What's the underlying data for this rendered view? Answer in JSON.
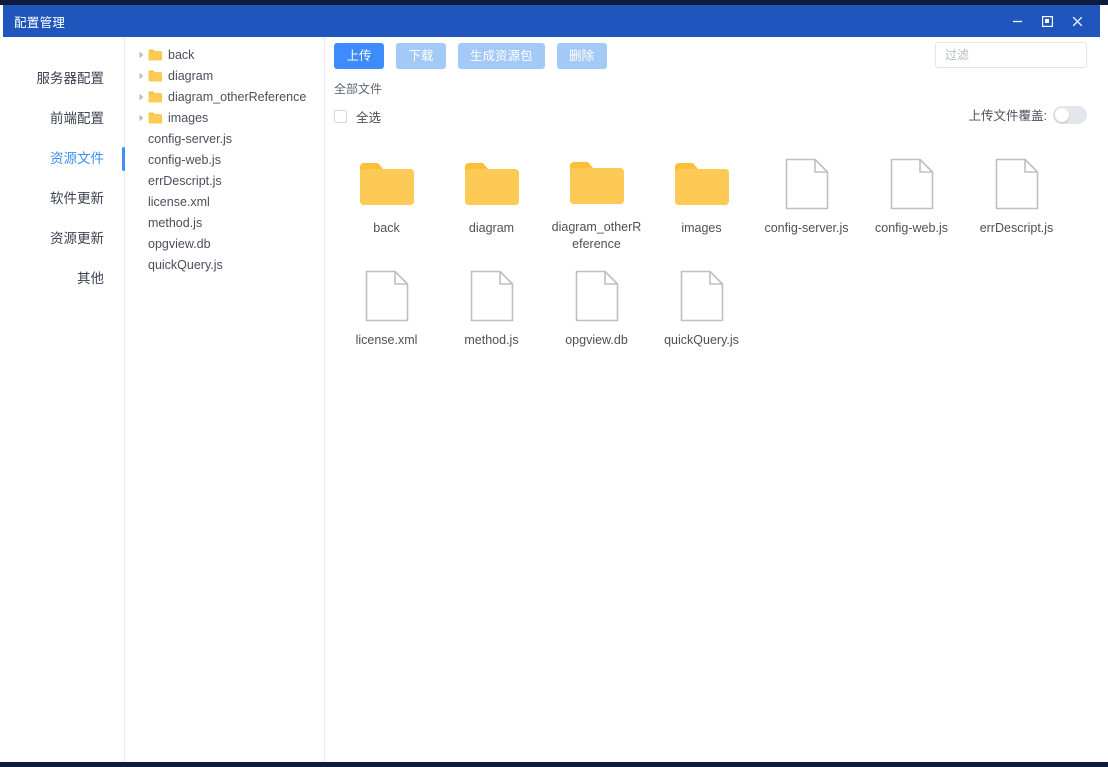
{
  "window": {
    "title": "配置管理",
    "controls": [
      {
        "name": "minimize-button",
        "glyph": "minimize-icon"
      },
      {
        "name": "maximize-button",
        "glyph": "maximize-icon"
      },
      {
        "name": "close-button",
        "glyph": "close-icon"
      }
    ]
  },
  "colors": {
    "titlebar": "#1f56bd",
    "accent": "#3d8bfd",
    "accent_muted": "#a3c9f7",
    "active_nav": "#3d90f5",
    "folder": "#fbbf3c",
    "file_outline": "#bcbfc6",
    "desktop": "#132a52"
  },
  "sidebar": {
    "items": [
      {
        "label": "服务器配置",
        "active": false
      },
      {
        "label": "前端配置",
        "active": false
      },
      {
        "label": "资源文件",
        "active": true
      },
      {
        "label": "软件更新",
        "active": false
      },
      {
        "label": "资源更新",
        "active": false
      },
      {
        "label": "其他",
        "active": false
      }
    ]
  },
  "tree": {
    "nodes": [
      {
        "label": "back",
        "type": "folder",
        "expandable": true
      },
      {
        "label": "diagram",
        "type": "folder",
        "expandable": true
      },
      {
        "label": "diagram_otherReference",
        "type": "folder",
        "expandable": true
      },
      {
        "label": "images",
        "type": "folder",
        "expandable": true
      },
      {
        "label": "config-server.js",
        "type": "file",
        "expandable": false
      },
      {
        "label": "config-web.js",
        "type": "file",
        "expandable": false
      },
      {
        "label": "errDescript.js",
        "type": "file",
        "expandable": false
      },
      {
        "label": "license.xml",
        "type": "file",
        "expandable": false
      },
      {
        "label": "method.js",
        "type": "file",
        "expandable": false
      },
      {
        "label": "opgview.db",
        "type": "file",
        "expandable": false
      },
      {
        "label": "quickQuery.js",
        "type": "file",
        "expandable": false
      }
    ]
  },
  "toolbar": {
    "upload_label": "上传",
    "download_label": "下载",
    "package_label": "生成资源包",
    "delete_label": "删除"
  },
  "filter": {
    "placeholder": "过滤",
    "value": ""
  },
  "breadcrumb": {
    "text": "全部文件"
  },
  "select_all": {
    "label": "全选",
    "checked": false
  },
  "overwrite": {
    "label": "上传文件覆盖:",
    "on": false
  },
  "files": [
    {
      "name": "back",
      "type": "folder"
    },
    {
      "name": "diagram",
      "type": "folder"
    },
    {
      "name": "diagram_otherReference",
      "type": "folder"
    },
    {
      "name": "images",
      "type": "folder"
    },
    {
      "name": "config-server.js",
      "type": "file"
    },
    {
      "name": "config-web.js",
      "type": "file"
    },
    {
      "name": "errDescript.js",
      "type": "file"
    },
    {
      "name": "license.xml",
      "type": "file"
    },
    {
      "name": "method.js",
      "type": "file"
    },
    {
      "name": "opgview.db",
      "type": "file"
    },
    {
      "name": "quickQuery.js",
      "type": "file"
    }
  ]
}
